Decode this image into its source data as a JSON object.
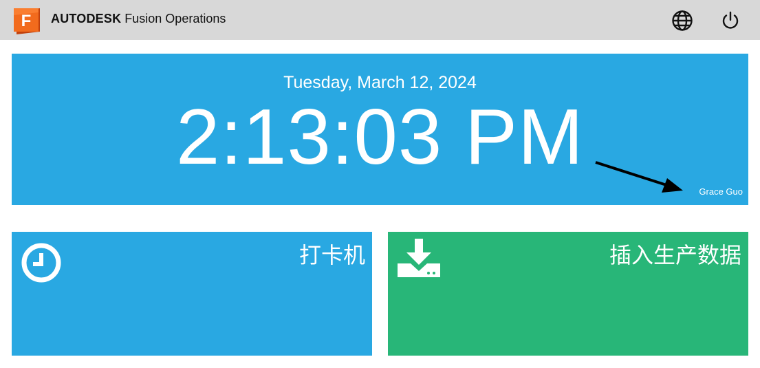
{
  "header": {
    "brand_strong": "AUTODESK",
    "brand_light": "Fusion Operations",
    "logo_letter": "F",
    "icons": [
      "globe-icon",
      "power-icon"
    ]
  },
  "clock": {
    "date": "Tuesday, March 12, 2024",
    "time": "2:13:03 PM",
    "user": "Grace Guo"
  },
  "tiles": [
    {
      "label": "打卡机",
      "icon": "clock-icon",
      "color": "#29a8e2"
    },
    {
      "label": "插入生产数据",
      "icon": "download-icon",
      "color": "#28b678"
    }
  ],
  "colors": {
    "topbar": "#d8d8d8",
    "panel_blue": "#29a8e2",
    "tile_green": "#28b678",
    "logo_orange": "#f26b1d"
  }
}
